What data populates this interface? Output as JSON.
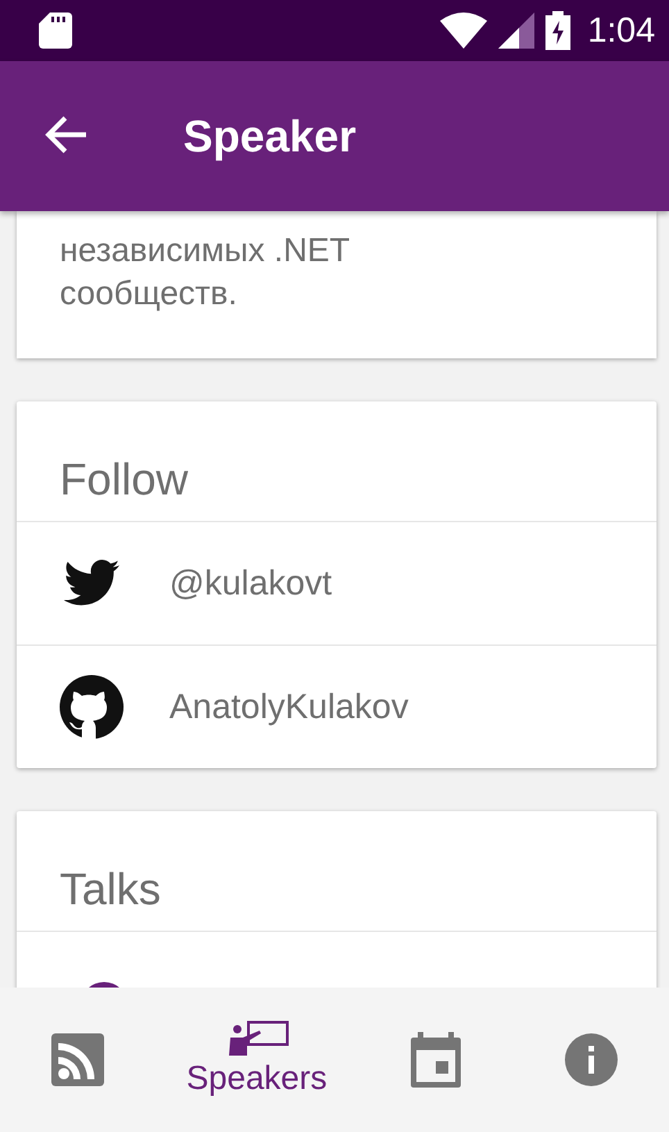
{
  "status_bar": {
    "time": "1:04"
  },
  "app_bar": {
    "title": "Speaker"
  },
  "bio": {
    "lines": [
      "независимых .NET",
      "сообществ."
    ]
  },
  "follow": {
    "title": "Follow",
    "links": [
      {
        "kind": "twitter",
        "text": "@kulakovt"
      },
      {
        "kind": "github",
        "text": "AnatolyKulakov"
      }
    ]
  },
  "talks": {
    "title": "Talks"
  },
  "bottom_nav": [
    {
      "kind": "feed",
      "selected": false
    },
    {
      "kind": "speakers",
      "label": "Speakers",
      "selected": true
    },
    {
      "kind": "calendar",
      "selected": false
    },
    {
      "kind": "info",
      "selected": false
    }
  ]
}
